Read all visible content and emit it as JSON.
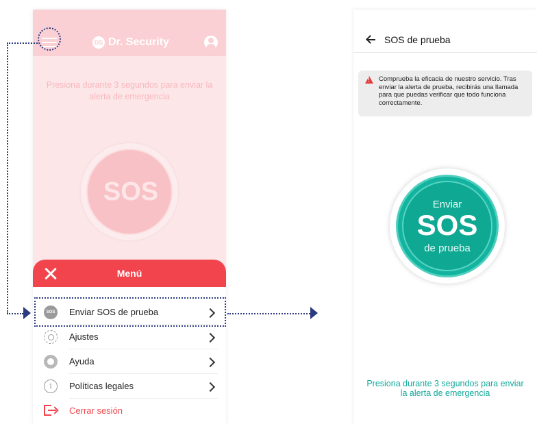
{
  "left_screen": {
    "brand": {
      "logo_text": "DS",
      "name": "Dr. Security"
    },
    "instruction": "Presiona durante 3 segundos para enviar la alerta de emergencia",
    "sos_label": "SOS",
    "menu": {
      "title": "Menú",
      "items": [
        {
          "label": "Enviar SOS de prueba",
          "icon": "sos-mini-icon",
          "icon_text": "SOS"
        },
        {
          "label": "Ajustes",
          "icon": "gear-icon"
        },
        {
          "label": "Ayuda",
          "icon": "lifebuoy-icon"
        },
        {
          "label": "Políticas legales",
          "icon": "info-icon",
          "icon_text": "i"
        },
        {
          "label": "Cerrar sesión",
          "icon": "logout-icon"
        }
      ]
    }
  },
  "right_screen": {
    "title": "SOS de prueba",
    "banner_text": "Comprueba la eficacia de nuestro servicio. Tras enviar la alerta de prueba, recibirás una llamada para que puedas verificar que todo funciona correctamente.",
    "sos_button": {
      "top": "Enviar",
      "main": "SOS",
      "bottom": "de prueba"
    },
    "instruction": "Presiona durante 3 segundos para enviar la alerta de emergencia"
  },
  "colors": {
    "brand_red": "#f2444d",
    "teal": "#12b4a0",
    "annotation_navy": "#2c3a80"
  }
}
